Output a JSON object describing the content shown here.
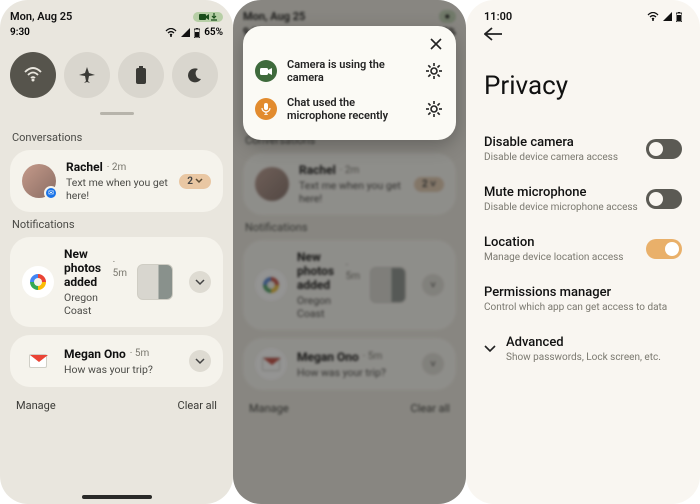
{
  "panel1": {
    "date": "Mon, Aug 25",
    "time": "9:30",
    "battery": "65%",
    "quick_settings": [
      {
        "name": "wifi",
        "active": true
      },
      {
        "name": "airplane",
        "active": false
      },
      {
        "name": "battery",
        "active": false
      },
      {
        "name": "dnd",
        "active": false
      }
    ],
    "sec_conversations": "Conversations",
    "conv": {
      "name": "Rachel",
      "meta": "2m",
      "text": "Text me when you get here!",
      "badge": "2"
    },
    "sec_notifications": "Notifications",
    "photos": {
      "title": "New photos added",
      "meta": "5m",
      "sub": "Oregon Coast"
    },
    "gmail": {
      "from": "Megan Ono",
      "meta": "5m",
      "text": "How was your trip?"
    },
    "manage": "Manage",
    "clear_all": "Clear all"
  },
  "panel2": {
    "popup": {
      "row1": "Camera is using the camera",
      "row2": "Chat used the microphone recently"
    }
  },
  "panel3": {
    "time": "11:00",
    "title": "Privacy",
    "items": [
      {
        "title": "Disable camera",
        "sub": "Disable device camera access",
        "toggle": "off"
      },
      {
        "title": "Mute microphone",
        "sub": "Disable device microphone access",
        "toggle": "off"
      },
      {
        "title": "Location",
        "sub": "Manage device location access",
        "toggle": "on"
      },
      {
        "title": "Permissions manager",
        "sub": "Control which app can get access to data",
        "toggle": null
      },
      {
        "title": "Advanced",
        "sub": "Show passwords, Lock screen, etc.",
        "toggle": null,
        "expandable": true
      }
    ]
  }
}
